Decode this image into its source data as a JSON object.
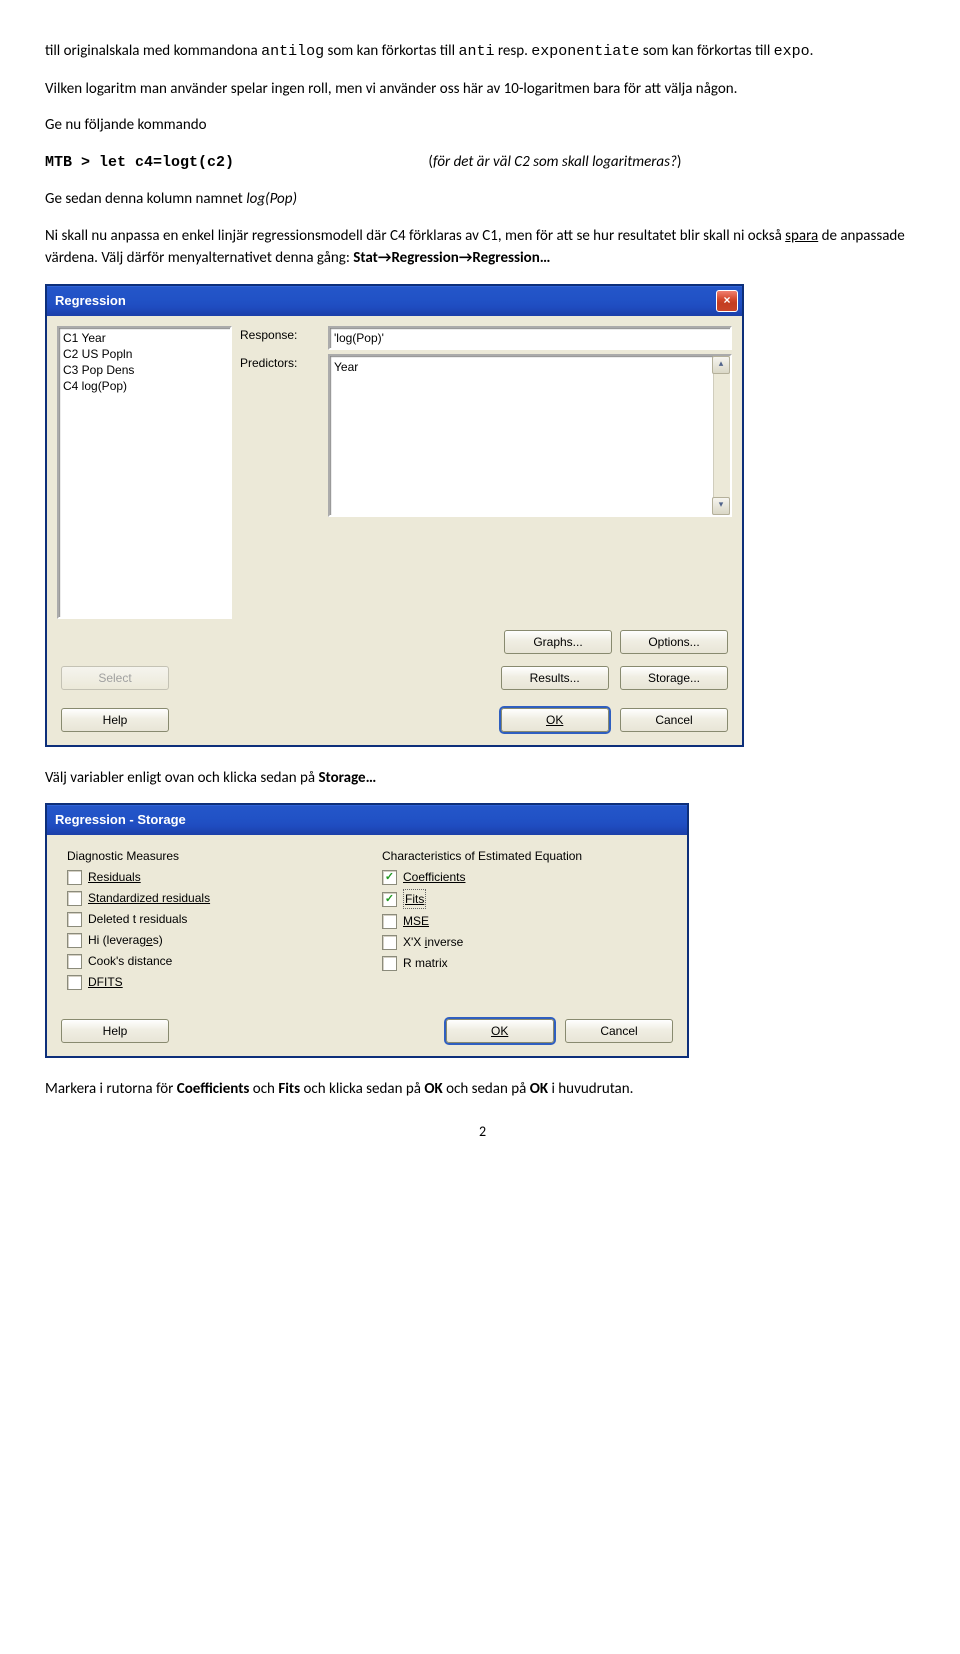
{
  "para1a": "till originalskala med kommandona ",
  "para1b": "antilog",
  "para1c": " som kan förkortas till ",
  "para1d": "anti",
  "para1e": " resp. ",
  "para1f": "exponentiate",
  "para1g": " som kan förkortas till ",
  "para1h": "expo",
  "para1i": ".",
  "para2": "Vilken logaritm man använder spelar ingen roll, men vi använder oss här av 10-logaritmen bara för att välja någon.",
  "para3": "Ge nu följande kommando",
  "cmd_prompt": "MTB > let c4=logt(c2)",
  "cmd_note_open": "(",
  "cmd_note_it": "för det är väl C2 som skall logaritmeras?",
  "cmd_note_close": ")",
  "para4a": "Ge sedan denna kolumn namnet ",
  "para4b": "log(Pop)",
  "para5a": "Ni skall nu anpassa en enkel linjär regressionsmodell där C4 förklaras av C1, men för att se hur resultatet blir skall ni också ",
  "para5b": "spara",
  "para5c": " de anpassade värdena. Välj därför menyalternativet denna gång: ",
  "para5d": "Stat",
  "arrow": "→",
  "para5e": "Regression",
  "para5f": "Regression…",
  "reg": {
    "title": "Regression",
    "list": {
      "c1": "C1    Year",
      "c2": "C2    US Popln",
      "c3": "C3    Pop Dens",
      "c4": "C4    log(Pop)"
    },
    "response_label": "Response:",
    "response_value": "'log(Pop)'",
    "predictors_label": "Predictors:",
    "predictors_value": "Year",
    "btn_graphs": "Graphs...",
    "btn_options": "Options...",
    "btn_results": "Results...",
    "btn_storage": "Storage...",
    "btn_select": "Select",
    "btn_help": "Help",
    "btn_ok": "OK",
    "btn_cancel": "Cancel"
  },
  "para6a": "Välj variabler enligt ovan och klicka sedan på ",
  "para6b": "Storage…",
  "storage": {
    "title": "Regression - Storage",
    "hdr_left": "Diagnostic Measures",
    "hdr_right": "Characteristics of Estimated Equation",
    "left": {
      "residuals": "Residuals",
      "stdres": "Standardized residuals",
      "delt": "Deleted t residuals",
      "hi_pre": "Hi (leverag",
      "hi_u": "e",
      "hi_post": "s)",
      "cook": "Cook's distance",
      "dfits": "DFITS"
    },
    "right": {
      "coeff": "Coefficients",
      "fits": "Fits",
      "mse": "MSE",
      "xx_pre": "X'X ",
      "xx_u": "i",
      "xx_post": "nverse",
      "rmat": "R matrix"
    },
    "btn_help": "Help",
    "btn_ok": "OK",
    "btn_cancel": "Cancel"
  },
  "para7a": "Markera i rutorna för ",
  "para7b": "Coefficients",
  "para7c": " och ",
  "para7d": "Fits",
  "para7e": " och klicka sedan på ",
  "para7f": "OK",
  "para7g": " och sedan på ",
  "para7h": "OK",
  "para7i": " i huvudrutan.",
  "page": "2"
}
